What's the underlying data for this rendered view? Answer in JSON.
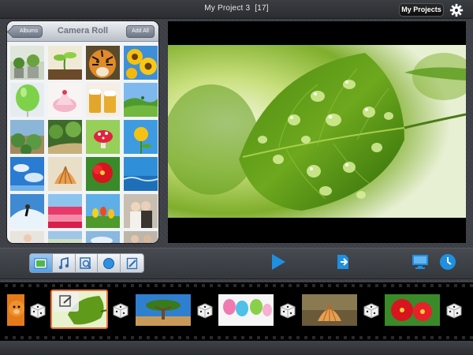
{
  "window": {
    "project_title": "My Project 3",
    "clip_count": "[17]",
    "my_projects_label": "My Projects",
    "settings_icon": "gear-icon"
  },
  "browser": {
    "albums_label": "Albums",
    "title": "Camera Roll",
    "add_all_label": "Add All",
    "thumbnails": [
      "potted-plants",
      "green-sprout",
      "tiger",
      "sunflowers",
      "green-balloon",
      "pink-cake",
      "beer-mugs",
      "green-hills",
      "cactus-field",
      "garden-path",
      "mushroom",
      "yellow-flower",
      "blue-sky",
      "seashell",
      "red-flower",
      "blue-water",
      "surfer",
      "tulip-field",
      "tulips",
      "couple-photo",
      "person",
      "landscape",
      "sky",
      "people"
    ]
  },
  "preview": {
    "subject": "leaf-with-water-drops"
  },
  "toolbar": {
    "tabs": [
      {
        "name": "photo-tab",
        "icon": "photo-icon",
        "active": true
      },
      {
        "name": "music-tab",
        "icon": "music-note-icon",
        "active": false
      },
      {
        "name": "search-tab",
        "icon": "magnifier-icon",
        "active": false
      },
      {
        "name": "circle-tab",
        "icon": "circle-icon",
        "active": false
      },
      {
        "name": "edit-tab",
        "icon": "pencil-icon",
        "active": false
      }
    ],
    "play_icon": "play-icon",
    "export_icon": "export-icon",
    "display_icon": "monitor-icon",
    "clock_icon": "clock-icon",
    "accent": "#1f8fe0"
  },
  "filmstrip": {
    "clips": [
      "teddy-bear",
      "leaf",
      "dragon-tree",
      "balloons",
      "seashell",
      "red-flower"
    ],
    "transition_icon": "dice-icon",
    "selection_color": "#e8743a"
  }
}
